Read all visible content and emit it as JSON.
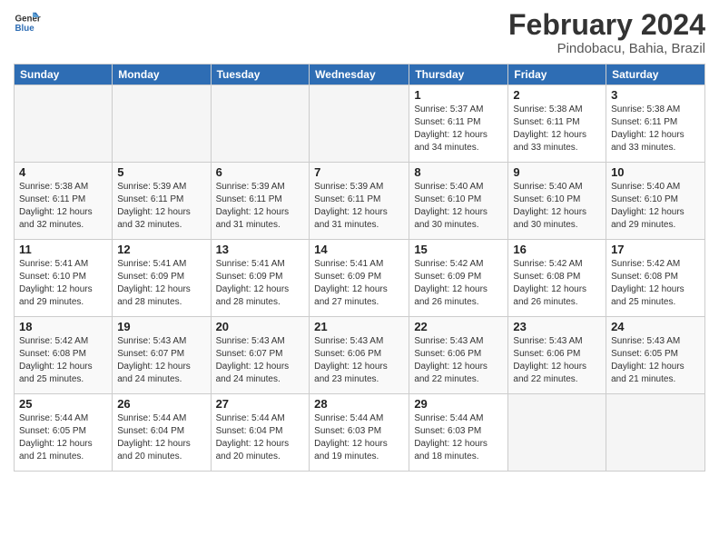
{
  "logo": {
    "line1": "General",
    "line2": "Blue"
  },
  "title": "February 2024",
  "subtitle": "Pindobacu, Bahia, Brazil",
  "weekdays": [
    "Sunday",
    "Monday",
    "Tuesday",
    "Wednesday",
    "Thursday",
    "Friday",
    "Saturday"
  ],
  "weeks": [
    [
      {
        "day": "",
        "info": ""
      },
      {
        "day": "",
        "info": ""
      },
      {
        "day": "",
        "info": ""
      },
      {
        "day": "",
        "info": ""
      },
      {
        "day": "1",
        "info": "Sunrise: 5:37 AM\nSunset: 6:11 PM\nDaylight: 12 hours\nand 34 minutes."
      },
      {
        "day": "2",
        "info": "Sunrise: 5:38 AM\nSunset: 6:11 PM\nDaylight: 12 hours\nand 33 minutes."
      },
      {
        "day": "3",
        "info": "Sunrise: 5:38 AM\nSunset: 6:11 PM\nDaylight: 12 hours\nand 33 minutes."
      }
    ],
    [
      {
        "day": "4",
        "info": "Sunrise: 5:38 AM\nSunset: 6:11 PM\nDaylight: 12 hours\nand 32 minutes."
      },
      {
        "day": "5",
        "info": "Sunrise: 5:39 AM\nSunset: 6:11 PM\nDaylight: 12 hours\nand 32 minutes."
      },
      {
        "day": "6",
        "info": "Sunrise: 5:39 AM\nSunset: 6:11 PM\nDaylight: 12 hours\nand 31 minutes."
      },
      {
        "day": "7",
        "info": "Sunrise: 5:39 AM\nSunset: 6:11 PM\nDaylight: 12 hours\nand 31 minutes."
      },
      {
        "day": "8",
        "info": "Sunrise: 5:40 AM\nSunset: 6:10 PM\nDaylight: 12 hours\nand 30 minutes."
      },
      {
        "day": "9",
        "info": "Sunrise: 5:40 AM\nSunset: 6:10 PM\nDaylight: 12 hours\nand 30 minutes."
      },
      {
        "day": "10",
        "info": "Sunrise: 5:40 AM\nSunset: 6:10 PM\nDaylight: 12 hours\nand 29 minutes."
      }
    ],
    [
      {
        "day": "11",
        "info": "Sunrise: 5:41 AM\nSunset: 6:10 PM\nDaylight: 12 hours\nand 29 minutes."
      },
      {
        "day": "12",
        "info": "Sunrise: 5:41 AM\nSunset: 6:09 PM\nDaylight: 12 hours\nand 28 minutes."
      },
      {
        "day": "13",
        "info": "Sunrise: 5:41 AM\nSunset: 6:09 PM\nDaylight: 12 hours\nand 28 minutes."
      },
      {
        "day": "14",
        "info": "Sunrise: 5:41 AM\nSunset: 6:09 PM\nDaylight: 12 hours\nand 27 minutes."
      },
      {
        "day": "15",
        "info": "Sunrise: 5:42 AM\nSunset: 6:09 PM\nDaylight: 12 hours\nand 26 minutes."
      },
      {
        "day": "16",
        "info": "Sunrise: 5:42 AM\nSunset: 6:08 PM\nDaylight: 12 hours\nand 26 minutes."
      },
      {
        "day": "17",
        "info": "Sunrise: 5:42 AM\nSunset: 6:08 PM\nDaylight: 12 hours\nand 25 minutes."
      }
    ],
    [
      {
        "day": "18",
        "info": "Sunrise: 5:42 AM\nSunset: 6:08 PM\nDaylight: 12 hours\nand 25 minutes."
      },
      {
        "day": "19",
        "info": "Sunrise: 5:43 AM\nSunset: 6:07 PM\nDaylight: 12 hours\nand 24 minutes."
      },
      {
        "day": "20",
        "info": "Sunrise: 5:43 AM\nSunset: 6:07 PM\nDaylight: 12 hours\nand 24 minutes."
      },
      {
        "day": "21",
        "info": "Sunrise: 5:43 AM\nSunset: 6:06 PM\nDaylight: 12 hours\nand 23 minutes."
      },
      {
        "day": "22",
        "info": "Sunrise: 5:43 AM\nSunset: 6:06 PM\nDaylight: 12 hours\nand 22 minutes."
      },
      {
        "day": "23",
        "info": "Sunrise: 5:43 AM\nSunset: 6:06 PM\nDaylight: 12 hours\nand 22 minutes."
      },
      {
        "day": "24",
        "info": "Sunrise: 5:43 AM\nSunset: 6:05 PM\nDaylight: 12 hours\nand 21 minutes."
      }
    ],
    [
      {
        "day": "25",
        "info": "Sunrise: 5:44 AM\nSunset: 6:05 PM\nDaylight: 12 hours\nand 21 minutes."
      },
      {
        "day": "26",
        "info": "Sunrise: 5:44 AM\nSunset: 6:04 PM\nDaylight: 12 hours\nand 20 minutes."
      },
      {
        "day": "27",
        "info": "Sunrise: 5:44 AM\nSunset: 6:04 PM\nDaylight: 12 hours\nand 20 minutes."
      },
      {
        "day": "28",
        "info": "Sunrise: 5:44 AM\nSunset: 6:03 PM\nDaylight: 12 hours\nand 19 minutes."
      },
      {
        "day": "29",
        "info": "Sunrise: 5:44 AM\nSunset: 6:03 PM\nDaylight: 12 hours\nand 18 minutes."
      },
      {
        "day": "",
        "info": ""
      },
      {
        "day": "",
        "info": ""
      }
    ]
  ]
}
